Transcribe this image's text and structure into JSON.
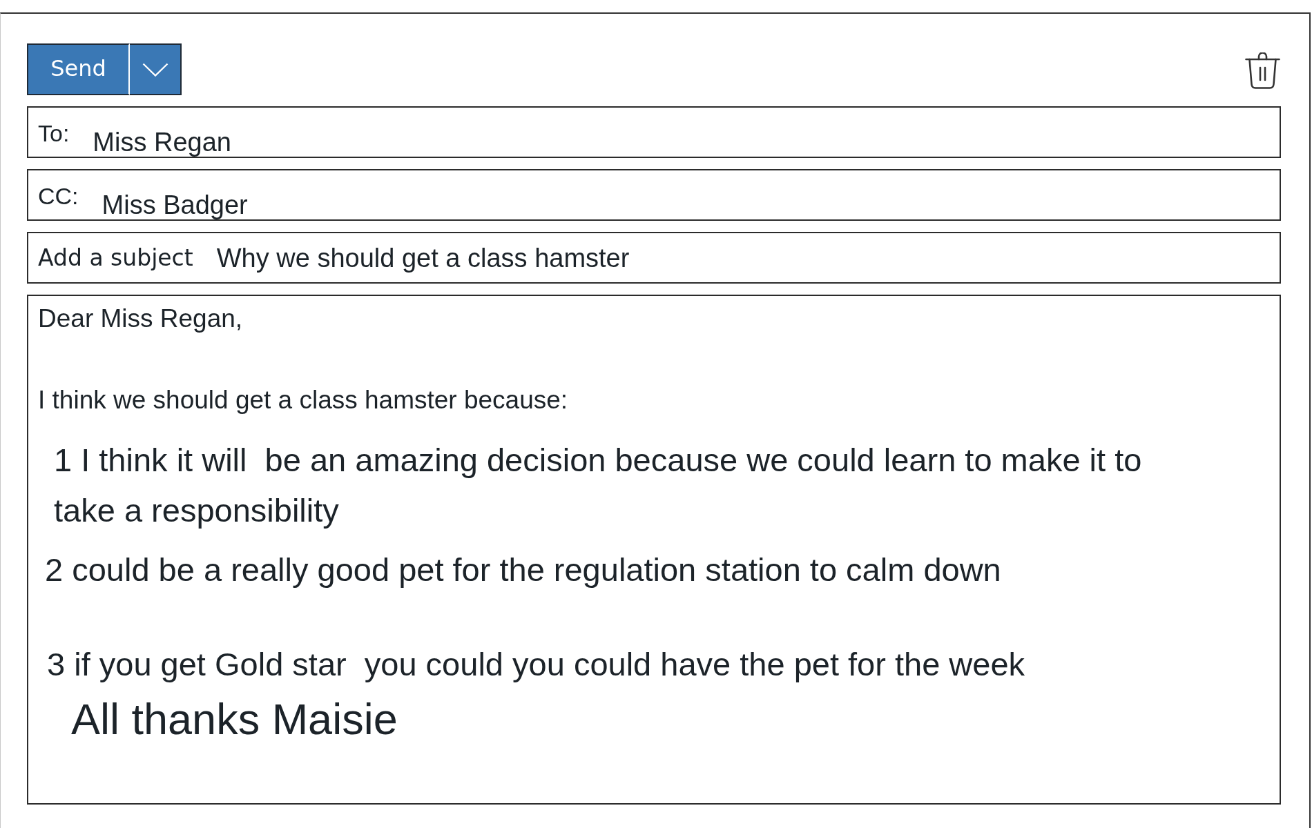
{
  "toolbar": {
    "send_button": {
      "label": "Send"
    }
  },
  "fields": [
    {
      "kind": "recipient",
      "label": "To:",
      "value": "Miss Regan"
    },
    {
      "kind": "recipient",
      "label": "CC:",
      "value": "Miss Badger"
    },
    {
      "kind": "subject",
      "label": "Add a subject",
      "value": "Why we should get a class hamster"
    }
  ],
  "body": {
    "greeting": "Dear Miss Regan,",
    "intro": "I think we should get a class hamster because:",
    "points": [
      {
        "lines": [
          "1 I think it will  be an amazing decision because we could learn to make it to",
          "take a responsibility"
        ]
      },
      {
        "lines": [
          "2 could be a really good pet for the regulation station to calm down"
        ]
      },
      {
        "lines": [
          "3 if you get Gold star  you could you could have the pet for the week"
        ]
      }
    ],
    "closing": "All thanks Maisie"
  }
}
